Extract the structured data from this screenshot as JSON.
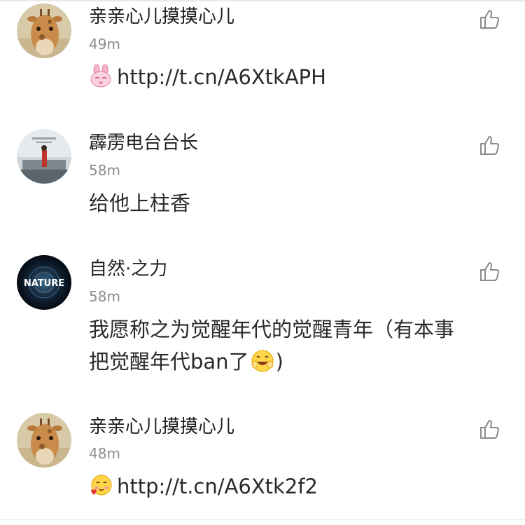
{
  "comments": [
    {
      "username": "亲亲心儿摸摸心儿",
      "time": "49m",
      "emoji_icon": "pink-bunny-emoji-icon",
      "text_lines": [
        "http://t.cn/A6XtkAPH"
      ]
    },
    {
      "username": "霹雳电台台长",
      "time": "58m",
      "text_lines": [
        "给他上柱香"
      ]
    },
    {
      "username": "自然·之力",
      "time": "58m",
      "avatar_text": "NATURE",
      "text_lines": [
        "我愿称之为觉醒年代的觉醒青年（有本事",
        "把觉醒年代ban了",
        ")"
      ],
      "emoji_icon": "grinning-face-emoji-icon"
    },
    {
      "username": "亲亲心儿摸摸心儿",
      "time": "48m",
      "emoji_icon": "blushing-heart-emoji-icon",
      "text_lines": [
        "http://t.cn/A6Xtk2f2"
      ]
    }
  ],
  "colors": {
    "username": "#1f1f1f",
    "time": "#8c8c8c",
    "like_icon": "#8a8a8a"
  }
}
